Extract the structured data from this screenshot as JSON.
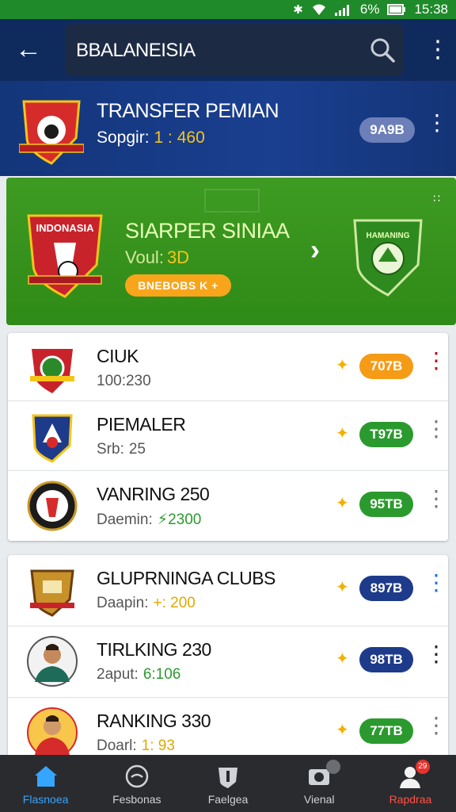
{
  "status_bar": {
    "battery": "6%",
    "time": "15:38"
  },
  "header": {
    "search_text": "BBALANEISIA"
  },
  "transfer": {
    "title": "TRANSFER PEMIAN",
    "sub_label": "Sopgir:",
    "sub_value": "1 : 460",
    "badge": "9A9B",
    "badge_color": "#6c7fb8"
  },
  "featured": {
    "crest_left_text": "INDONASIA",
    "crest_right_text": "HAMANING",
    "title": "SIARPER SINIAA",
    "sub_label": "Voul:",
    "sub_value": "3D",
    "button": "BNEBOBS K +"
  },
  "list1": [
    {
      "title": "CIUK",
      "sub_label": "100:230",
      "sub_value": "",
      "badge": "707B",
      "badge_color": "#f59b16",
      "kebab_color": "#b5121b"
    },
    {
      "title": "PIEMALER",
      "sub_label": "Srb:",
      "sub_value": "25",
      "badge": "T97B",
      "badge_color": "#2b9a2e",
      "kebab_color": "#777"
    },
    {
      "title": "VANRING 250",
      "sub_label": "Daemin:",
      "sub_value": "⚡2300",
      "badge": "95TB",
      "badge_color": "#2b9a2e",
      "kebab_color": "#777"
    }
  ],
  "list2": [
    {
      "title": "GLUPRNINGA CLUBS",
      "sub_label": "Daapin:",
      "sub_value": "+: 200",
      "badge": "897B",
      "badge_color": "#1e3a8a",
      "kebab_color": "#1a73e8"
    },
    {
      "title": "TIRLKING 230",
      "sub_label": "2aput:",
      "sub_value": "6:106",
      "badge": "98TB",
      "badge_color": "#1e3a8a",
      "kebab_color": "#222"
    },
    {
      "title": "RANKING 330",
      "sub_label": "Doarl:",
      "sub_value": "1: 93",
      "badge": "77TB",
      "badge_color": "#2b9a2e",
      "kebab_color": "#777"
    }
  ],
  "nav": [
    {
      "label": "Flasnoea",
      "icon": "home-icon"
    },
    {
      "label": "Fesbonas",
      "icon": "whistle-icon"
    },
    {
      "label": "Faelgea",
      "icon": "shield-icon"
    },
    {
      "label": "Vienal",
      "icon": "photo-icon",
      "badge": ""
    },
    {
      "label": "Rapdraa",
      "icon": "user-icon",
      "badge": "29"
    }
  ]
}
